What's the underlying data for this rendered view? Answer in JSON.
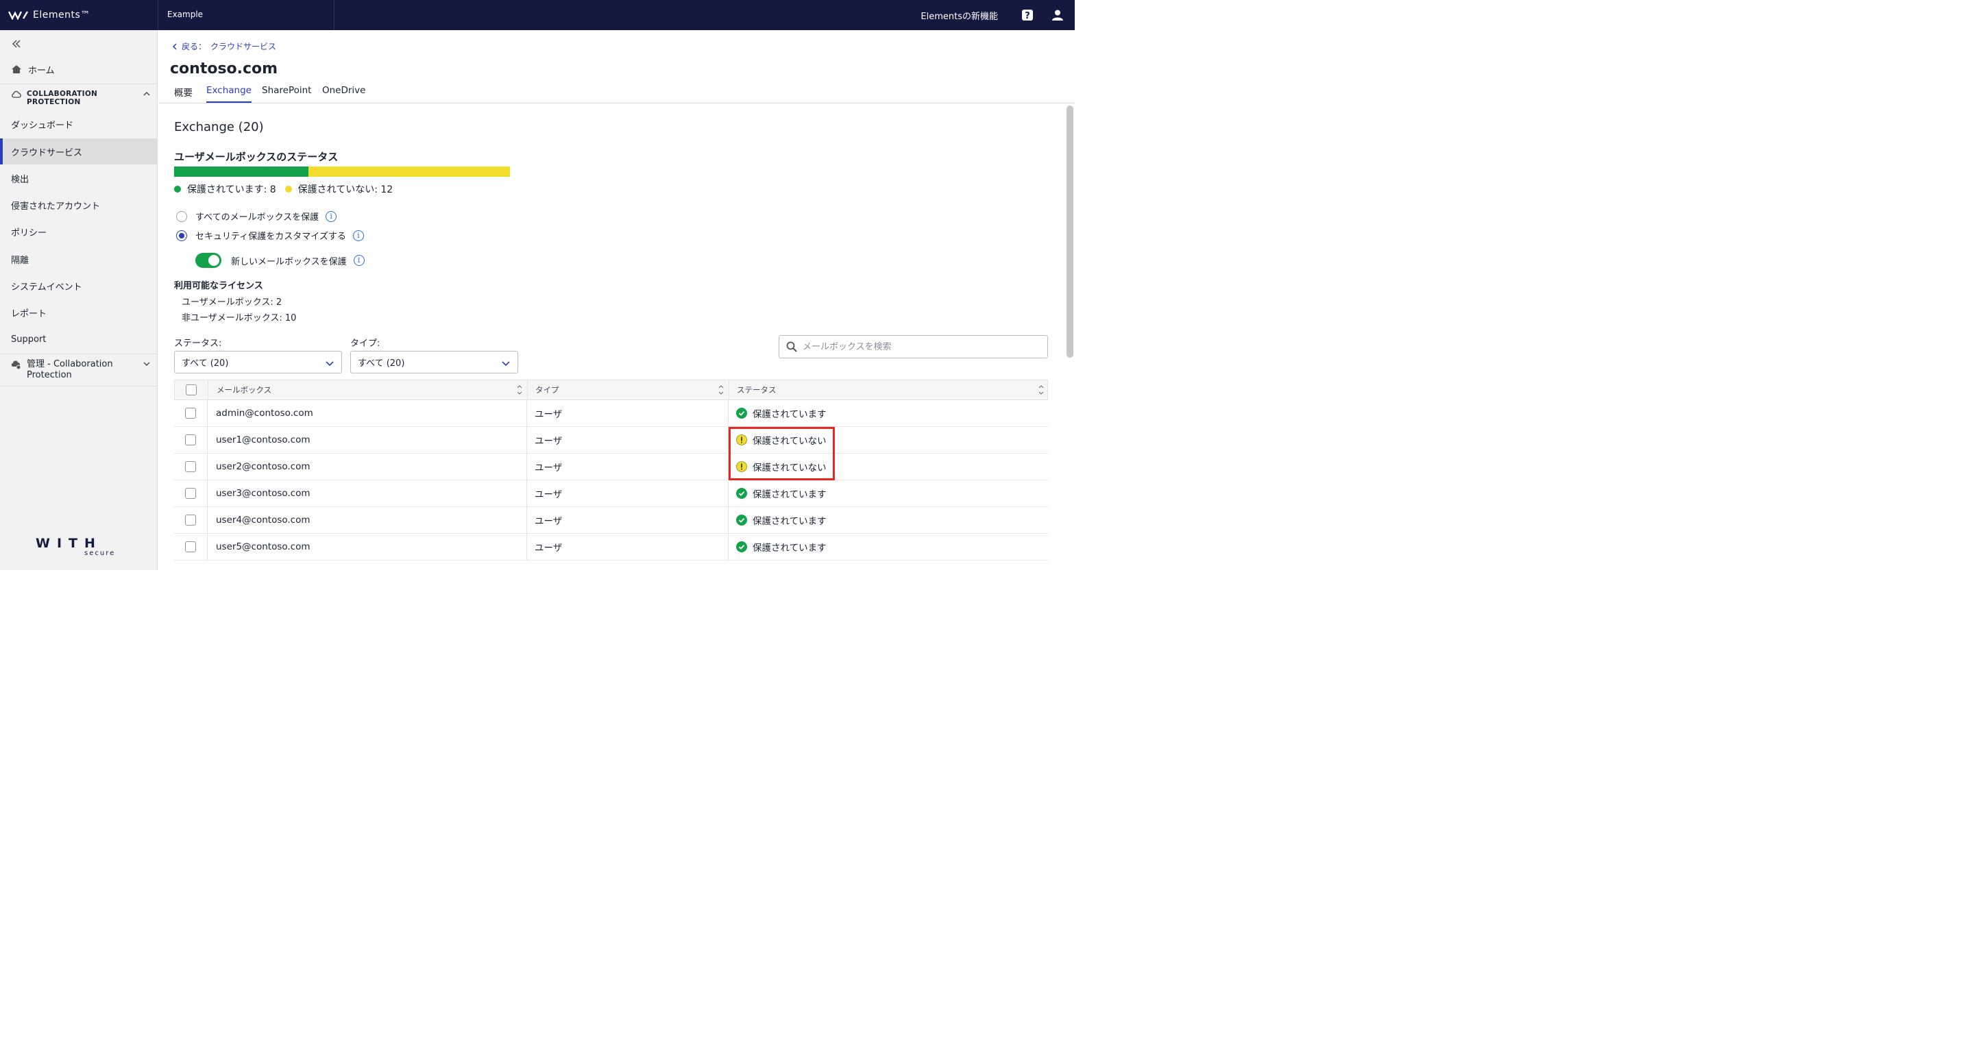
{
  "topbar": {
    "brand": "Elements™",
    "org": "Example",
    "whats_new": "Elementsの新機能",
    "help_icon": "help-icon",
    "user_icon": "user-icon"
  },
  "sidebar": {
    "home": "ホーム",
    "section_collab_line1": "COLLABORATION",
    "section_collab_line2": "PROTECTION",
    "items": [
      "ダッシュボード",
      "クラウドサービス",
      "検出",
      "侵害されたアカウント",
      "ポリシー",
      "隔離",
      "システムイベント",
      "レポート",
      "Support"
    ],
    "active_item": "クラウドサービス",
    "admin_line1": "管理 - Collaboration",
    "admin_line2": "Protection",
    "logo_text_main": "WITH",
    "logo_text_sub": "secure"
  },
  "main": {
    "back_label": "戻る：",
    "back_target": "クラウドサービス",
    "title": "contoso.com",
    "tabs": [
      "概要",
      "Exchange",
      "SharePoint",
      "OneDrive"
    ],
    "active_tab": "Exchange"
  },
  "exchange": {
    "heading": "Exchange (20)",
    "status_title": "ユーザメールボックスのステータス",
    "protected_count": 8,
    "unprotected_count": 12,
    "legend_protected": "保護されています: 8",
    "legend_unprotected": "保護されていない: 12",
    "colors": {
      "protected": "#12a34a",
      "unprotected": "#f0dd2c",
      "accent": "#2b3cb8"
    },
    "option_all": "すべてのメールボックスを保護",
    "option_custom": "セキュリティ保護をカスタマイズする",
    "selected_option": "custom",
    "toggle_label": "新しいメールボックスを保護",
    "toggle_on": true,
    "licenses_title": "利用可能なライセンス",
    "license_user": "ユーザメールボックス: 2",
    "license_nonuser": "非ユーザメールボックス: 10"
  },
  "filters": {
    "status_label": "ステータス:",
    "status_value": "すべて (20)",
    "type_label": "タイプ:",
    "type_value": "すべて (20)",
    "search_placeholder": "メールボックスを検索"
  },
  "table": {
    "columns": [
      "メールボックス",
      "タイプ",
      "ステータス"
    ],
    "rows": [
      {
        "mailbox": "admin@contoso.com",
        "type": "ユーザ",
        "status": "保護されています",
        "state": "ok"
      },
      {
        "mailbox": "user1@contoso.com",
        "type": "ユーザ",
        "status": "保護されていない",
        "state": "warn"
      },
      {
        "mailbox": "user2@contoso.com",
        "type": "ユーザ",
        "status": "保護されていない",
        "state": "warn"
      },
      {
        "mailbox": "user3@contoso.com",
        "type": "ユーザ",
        "status": "保護されています",
        "state": "ok"
      },
      {
        "mailbox": "user4@contoso.com",
        "type": "ユーザ",
        "status": "保護されています",
        "state": "ok"
      },
      {
        "mailbox": "user5@contoso.com",
        "type": "ユーザ",
        "status": "保護されています",
        "state": "ok"
      }
    ]
  }
}
